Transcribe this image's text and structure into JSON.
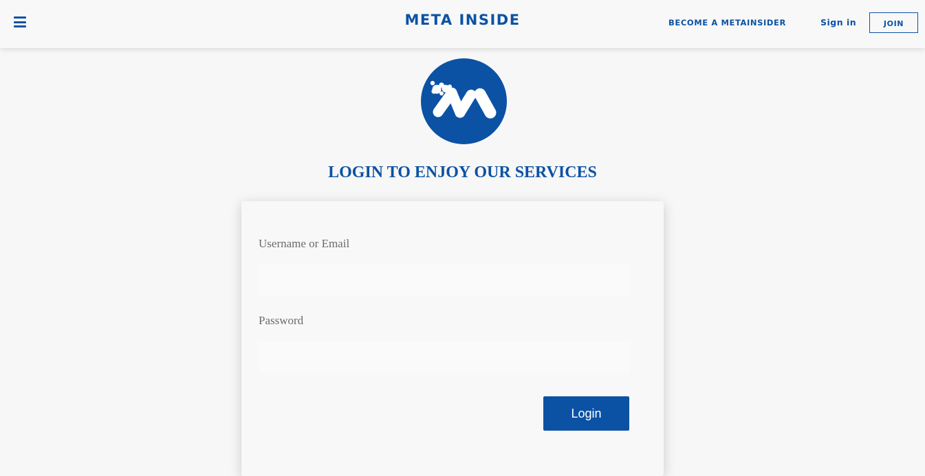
{
  "header": {
    "brand": "META INSIDE",
    "nav": {
      "become": "BECOME A METAINSIDER",
      "signin": "Sign in",
      "join": "JOIN"
    }
  },
  "main": {
    "heading": "LOGIN TO ENJOY OUR SERVICES",
    "form": {
      "username_label": "Username or Email",
      "username_value": "",
      "password_label": "Password",
      "password_value": "",
      "submit_label": "Login"
    }
  },
  "icons": {
    "menu": "hamburger-menu-icon",
    "logo": "meta-inside-logo"
  },
  "colors": {
    "brand_blue": "#0b52a4",
    "background": "#f7f7f7",
    "label_gray": "#6b6b6b"
  }
}
